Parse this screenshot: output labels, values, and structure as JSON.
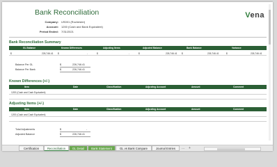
{
  "title": "Bank Reconciliation",
  "logo": {
    "prefix": "V",
    "rest": "ena"
  },
  "info": {
    "company_label": "Company:",
    "company_value": "US001 (Rochester)",
    "account_label": "Account:",
    "account_value": "1200 (Cash and Bank Equivalent)",
    "period_label": "Period Ended:",
    "period_value": "7/31/2021"
  },
  "summary": {
    "title": "Bank Reconciliation Summary",
    "headers": [
      "GL Balance",
      "Known Differences",
      "Adjusting Items",
      "Adjusted Balance",
      "Bank Balance",
      "Variance"
    ],
    "row": {
      "gl_cur": "$",
      "gl_balance": "226,746.41",
      "known_cur": "$",
      "known_dash": "-",
      "adj_cur": "$",
      "adj_dash": "-",
      "adjusted_cur": "$",
      "adjusted": "226,746.41",
      "bank_cur": "$",
      "bank": "226,746.41",
      "variance_cur": "$",
      "variance": "226,746.41"
    }
  },
  "balances": {
    "gl_label": "Balance Per GL",
    "gl_cur": "$",
    "gl_value": "226,746.41",
    "bank_label": "Balance Per Bank",
    "bank_cur": "$",
    "bank_value": "226,746.41"
  },
  "known": {
    "title": "Known Differences (+/-)",
    "headers": [
      "Item",
      "Date",
      "Classification",
      "Adjusting Account",
      "Amount",
      "Comment"
    ],
    "first_item": "1200 (Cash and Cash Equivalent)"
  },
  "adjusting": {
    "title": "Adjusting Items (+/-)",
    "headers": [
      "Item",
      "Date",
      "Classification",
      "Adjusting Account",
      "Amount",
      "Comment"
    ],
    "first_item": "1200 (Cash and Cash Equivalent)"
  },
  "totals": {
    "total_label": "Total Adjustments",
    "total_cur": "$",
    "total_value": "-",
    "adjusted_label": "Adjusted Balance",
    "adjusted_cur": "$",
    "adjusted_value": "226,746.41"
  },
  "tabs": [
    "Certification",
    "Reconciliation",
    "GL Detail",
    "Bank Statement",
    "GL vs Bank Compare",
    "Journal Entries"
  ],
  "nav": {
    "more": "...",
    "add": "+"
  }
}
